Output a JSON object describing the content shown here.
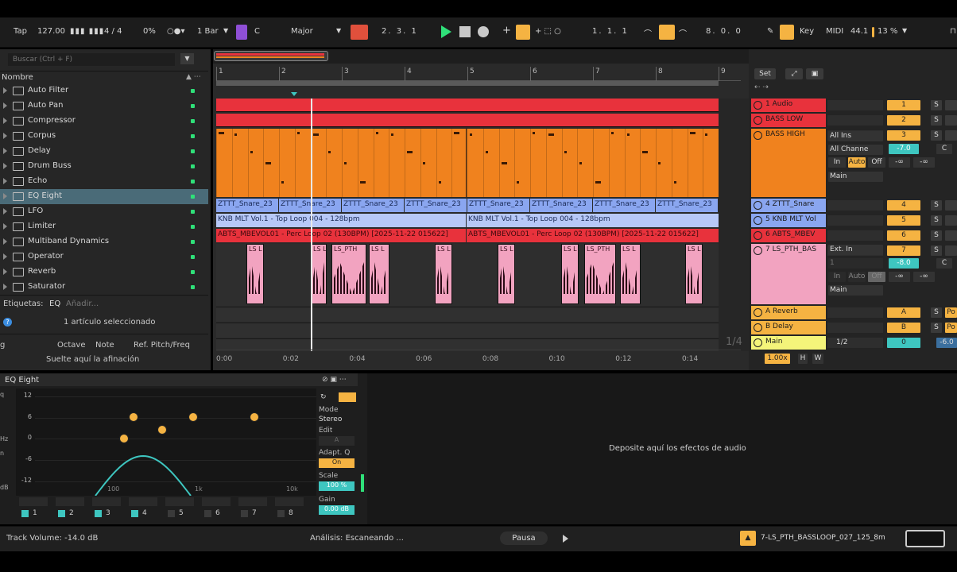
{
  "transport": {
    "tap": "Tap",
    "tempo": "127.00",
    "signature": "4 / 4",
    "swing": "0%",
    "quantize": "1 Bar",
    "key": "C",
    "scale": "Major",
    "position": "2.  3.  1",
    "loop_start": "1.  1.  1",
    "loop_length": "8.  0.  0",
    "key_label": "Key",
    "midi_label": "MIDI",
    "sample_rate": "44.1",
    "cpu": "13 %"
  },
  "browser": {
    "search_placeholder": "Buscar (Ctrl + F)",
    "column_header": "Nombre",
    "items": [
      {
        "label": "Auto Filter"
      },
      {
        "label": "Auto Pan"
      },
      {
        "label": "Compressor"
      },
      {
        "label": "Corpus"
      },
      {
        "label": "Delay"
      },
      {
        "label": "Drum Buss"
      },
      {
        "label": "Echo"
      },
      {
        "label": "EQ Eight",
        "selected": true
      },
      {
        "label": "LFO"
      },
      {
        "label": "Limiter"
      },
      {
        "label": "Multiband Dynamics"
      },
      {
        "label": "Operator"
      },
      {
        "label": "Reverb"
      },
      {
        "label": "Saturator"
      }
    ],
    "tags_label": "Etiquetas:",
    "tags_value": "EQ",
    "tags_add": "Añadir...",
    "selection_info": "1 artículo seleccionado",
    "tuning_headers": [
      "g",
      "Octave",
      "Note",
      "Ref. Pitch/Freq"
    ],
    "tuning_drop": "Suelte aquí la afinación"
  },
  "arrangement": {
    "bars": [
      "1",
      "2",
      "3",
      "4",
      "5",
      "6",
      "7",
      "8",
      "9"
    ],
    "times": [
      "0:00",
      "0:02",
      "0:04",
      "0:06",
      "0:08",
      "0:10",
      "0:12",
      "0:14"
    ],
    "zoom": "1/4",
    "snare_clip": "ZTTT_Snare_23",
    "kick_clip": "KNB MLT Vol.1 - Top Loop 004 - 128bpm",
    "perc_clip": "ABTS_MBEVOL01 - Perc Loop 02 (130BPM) [2025-11-22 015622]",
    "pth_clip": "LS_PTH",
    "pth_short": "LS L"
  },
  "mixer": {
    "set_label": "Set",
    "tracks": [
      {
        "name": "1 Audio",
        "num": "1",
        "color": "#e8323c"
      },
      {
        "name": "BASS LOW",
        "num": "2",
        "color": "#e8323c"
      },
      {
        "name": "BASS HIGH",
        "num": "3",
        "color": "#f0821e"
      },
      {
        "name": "4 ZTTT_Snare",
        "num": "4",
        "color": "#8aa6f0"
      },
      {
        "name": "5 KNB MLT Vol",
        "num": "5",
        "color": "#8aa6f0"
      },
      {
        "name": "6 ABTS_MBEV",
        "num": "6",
        "color": "#e8323c"
      },
      {
        "name": "7 LS_PTH_BAS",
        "num": "7",
        "color": "#f2a3c0"
      },
      {
        "name": "A Reverb",
        "num": "A",
        "color": "#f5b342"
      },
      {
        "name": "B Delay",
        "num": "B",
        "color": "#f5b342"
      },
      {
        "name": "Main",
        "num": "0",
        "color": "#f4f47a"
      }
    ],
    "input_all": "All Ins",
    "input_channels": "All Channe",
    "monitor": [
      "In",
      "Auto",
      "Off"
    ],
    "output_main": "Main",
    "ext_in": "Ext. In",
    "ext_ch": "1",
    "gain_value": "-7.0",
    "gain_value2": "-8.0",
    "neg_inf": "-∞",
    "solo": "S",
    "cue_label": "Po",
    "main_value": "0",
    "main_value2": "-6.0",
    "split": "1/2",
    "tempo_mult": "1.00x",
    "h_label": "H",
    "w_label": "W",
    "c_label": "C"
  },
  "device": {
    "title": "EQ Eight",
    "y_ticks": [
      "12",
      "6",
      "0",
      "-6",
      "-12"
    ],
    "freq_labels": [
      "100",
      "1k",
      "10k"
    ],
    "side_labels": [
      "q",
      "Hz",
      "n",
      "dB"
    ],
    "bands": [
      "1",
      "2",
      "3",
      "4",
      "5",
      "6",
      "7",
      "8"
    ],
    "mode_label": "Mode",
    "mode_value": "Stereo",
    "edit_label": "Edit",
    "edit_value": "A",
    "adapt_label": "Adapt. Q",
    "adapt_value": "On",
    "scale_label": "Scale",
    "scale_value": "100 %",
    "gain_label": "Gain",
    "gain_value": "0.00 dB"
  },
  "dropzone": {
    "text": "Deposite aquí los efectos de audio"
  },
  "status": {
    "track_volume": "Track Volume: -14.0 dB",
    "analysis": "Análisis: Escaneando ...",
    "pause": "Pausa",
    "file": "7-LS_PTH_BASSLOOP_027_125_8m"
  },
  "colors": {
    "red": "#e8323c",
    "orange": "#f0821e",
    "blue": "#8aa6f0",
    "pink": "#f2a3c0",
    "accent": "#f5b342",
    "teal": "#3ec6c0",
    "green": "#2fe079"
  }
}
